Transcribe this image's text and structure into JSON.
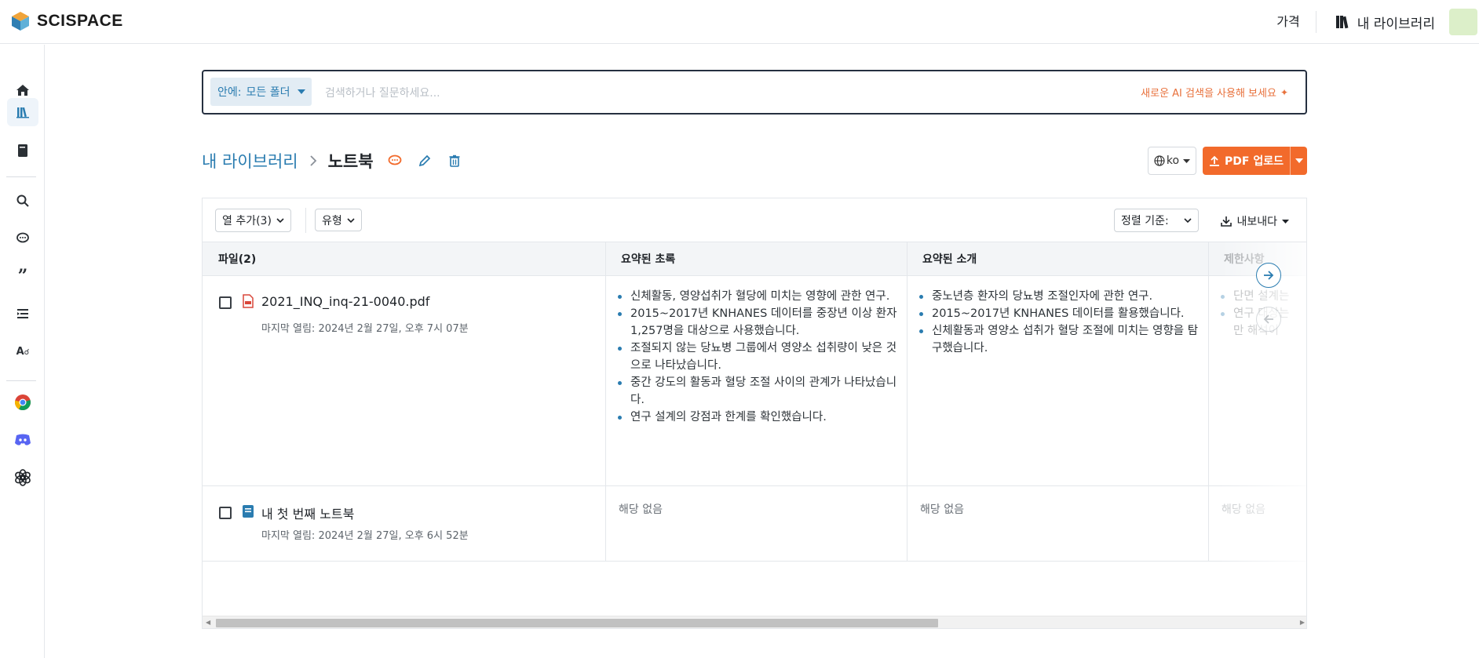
{
  "app": {
    "brand": "SCISPACE"
  },
  "topbar": {
    "price_label": "가격",
    "library_label": "내 라이브러리"
  },
  "sidebar": {
    "items": [
      {
        "icon": "home-icon"
      },
      {
        "icon": "library-icon",
        "active": true
      },
      {
        "icon": "book-icon"
      },
      {
        "icon": "literature-search-icon"
      },
      {
        "icon": "chat-pdf-icon"
      },
      {
        "icon": "citation-icon"
      },
      {
        "icon": "outline-icon"
      },
      {
        "icon": "ai-detector-icon"
      },
      {
        "icon": "chrome-extension-icon"
      },
      {
        "icon": "discord-icon"
      },
      {
        "icon": "openai-icon"
      }
    ]
  },
  "search": {
    "scope_label": "안에:",
    "scope_value": "모든 폴더",
    "placeholder": "검색하거나 질문하세요...",
    "ai_hint": "새로운 AI 검색을 사용해 보세요"
  },
  "breadcrumb": {
    "root": "내 라이브러리",
    "current": "노트북"
  },
  "actions": {
    "language": "ko",
    "upload_label": "PDF 업로드"
  },
  "toolbar": {
    "add_columns": "열 추가(3)",
    "type_filter": "유형",
    "sort_label": "정렬 기준:",
    "export_label": "내보내다"
  },
  "table": {
    "columns": [
      "파일(2)",
      "요약된 초록",
      "요약된 소개",
      "제한사항"
    ],
    "rows": [
      {
        "file_name": "2021_INQ_inq-21-0040.pdf",
        "file_type": "pdf",
        "meta": "마지막 열림: 2024년 2월 27일, 오후 7시 07분",
        "abstract": [
          "신체활동, 영양섭취가 혈당에 미치는 영향에 관한 연구.",
          "2015~2017년 KNHANES 데이터를 중장년 이상 환자 1,257명을 대상으로 사용했습니다.",
          "조절되지 않는 당뇨병 그룹에서 영양소 섭취량이 낮은 것으로 나타났습니다.",
          "중간 강도의 활동과 혈당 조절 사이의 관계가 나타났습니다.",
          "연구 설계의 강점과 한계를 확인했습니다."
        ],
        "intro": [
          "중노년층 환자의 당뇨병 조절인자에 관한 연구.",
          "2015~2017년 KNHANES 데이터를 활용했습니다.",
          "신체활동과 영양소 섭취가 혈당 조절에 미치는 영향을 탐구했습니다."
        ],
        "limitations": [
          "단면 설계는",
          "연구 대상는 만 해석이"
        ]
      },
      {
        "file_name": "내 첫 번째 노트북",
        "file_type": "notebook",
        "meta": "마지막 열림: 2024년 2월 27일, 오후 6시 52분",
        "abstract_na": "해당 없음",
        "intro_na": "해당 없음",
        "limitations_na": "해당 없음"
      }
    ]
  },
  "colors": {
    "accent_blue": "#2a7cb0",
    "accent_orange": "#f26a2b",
    "avatar_green": "#dcefc9"
  }
}
